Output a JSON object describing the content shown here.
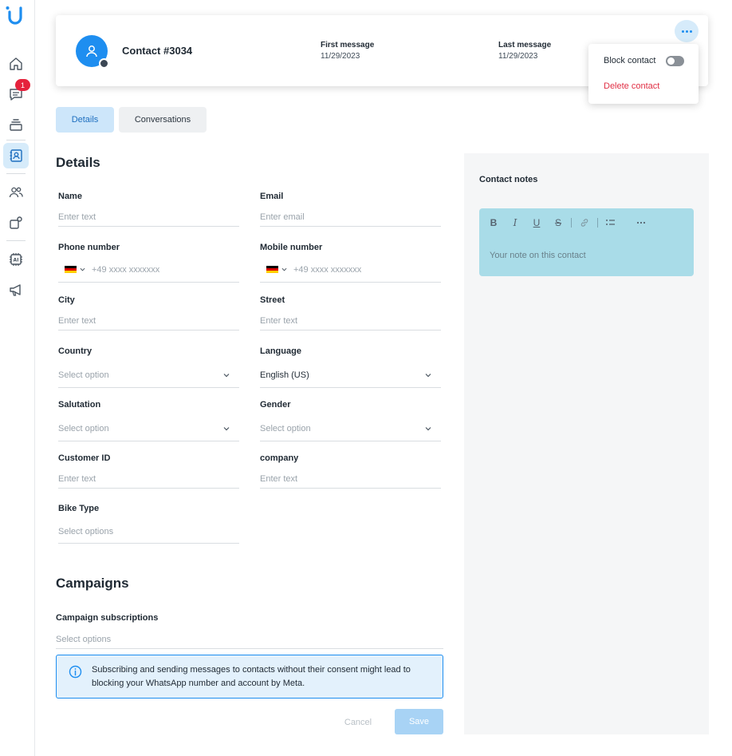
{
  "sidebar": {
    "logo_icon": "u-logo-icon",
    "items": [
      {
        "name": "home",
        "icon": "home-icon",
        "active": false
      },
      {
        "name": "inbox",
        "icon": "chat-icon",
        "active": false,
        "badge": "1"
      },
      {
        "name": "archive",
        "icon": "stack-icon",
        "active": false
      },
      {
        "name": "contacts",
        "icon": "contact-book-icon",
        "active": true
      },
      {
        "name": "team",
        "icon": "people-icon",
        "active": false
      },
      {
        "name": "integrations",
        "icon": "plugin-icon",
        "active": false
      },
      {
        "name": "ai",
        "icon": "ai-chip-icon",
        "active": false
      },
      {
        "name": "campaigns",
        "icon": "megaphone-icon",
        "active": false
      }
    ]
  },
  "header": {
    "contact_name": "Contact #3034",
    "first_message_label": "First message",
    "first_message_value": "11/29/2023",
    "last_message_label": "Last message",
    "last_message_value": "11/29/2023",
    "more_icon": "more-horizontal-icon"
  },
  "menu": {
    "block_label": "Block contact",
    "block_enabled": false,
    "delete_label": "Delete contact"
  },
  "tabs": [
    {
      "label": "Details",
      "active": true
    },
    {
      "label": "Conversations",
      "active": false
    }
  ],
  "details": {
    "title": "Details",
    "fields": {
      "name": {
        "label": "Name",
        "placeholder": "Enter text"
      },
      "email": {
        "label": "Email",
        "placeholder": "Enter email"
      },
      "phone": {
        "label": "Phone number",
        "placeholder": "+49 xxxx xxxxxxx"
      },
      "mobile": {
        "label": "Mobile number",
        "placeholder": "+49 xxxx xxxxxxx"
      },
      "city": {
        "label": "City",
        "placeholder": "Enter text"
      },
      "street": {
        "label": "Street",
        "placeholder": "Enter text"
      },
      "country": {
        "label": "Country",
        "placeholder": "Select option"
      },
      "language": {
        "label": "Language",
        "value": "English (US)"
      },
      "salutation": {
        "label": "Salutation",
        "placeholder": "Select option"
      },
      "gender": {
        "label": "Gender",
        "placeholder": "Select option"
      },
      "customer_id": {
        "label": "Customer ID",
        "placeholder": "Enter text"
      },
      "company": {
        "label": "company",
        "placeholder": "Enter text"
      },
      "bike_type": {
        "label": "Bike Type",
        "placeholder": "Select options"
      }
    }
  },
  "notes": {
    "title": "Contact notes",
    "placeholder": "Your note on this contact",
    "toolbar": {
      "bold": "B",
      "italic": "I",
      "underline": "U",
      "strike": "S"
    }
  },
  "campaigns": {
    "title": "Campaigns",
    "subscriptions_label": "Campaign subscriptions",
    "subscriptions_placeholder": "Select options",
    "info_text": "Subscribing and sending messages to contacts without their consent might lead to blocking your WhatsApp number and account by Meta."
  },
  "actions": {
    "cancel_label": "Cancel",
    "save_label": "Save"
  },
  "colors": {
    "accent": "#1e8ef0",
    "active_tab_bg": "#cde6fa",
    "danger": "#e02f44",
    "notes_bg": "#a9dce8",
    "flag_black": "#000000",
    "flag_red": "#dd0000",
    "flag_gold": "#ffce00"
  }
}
